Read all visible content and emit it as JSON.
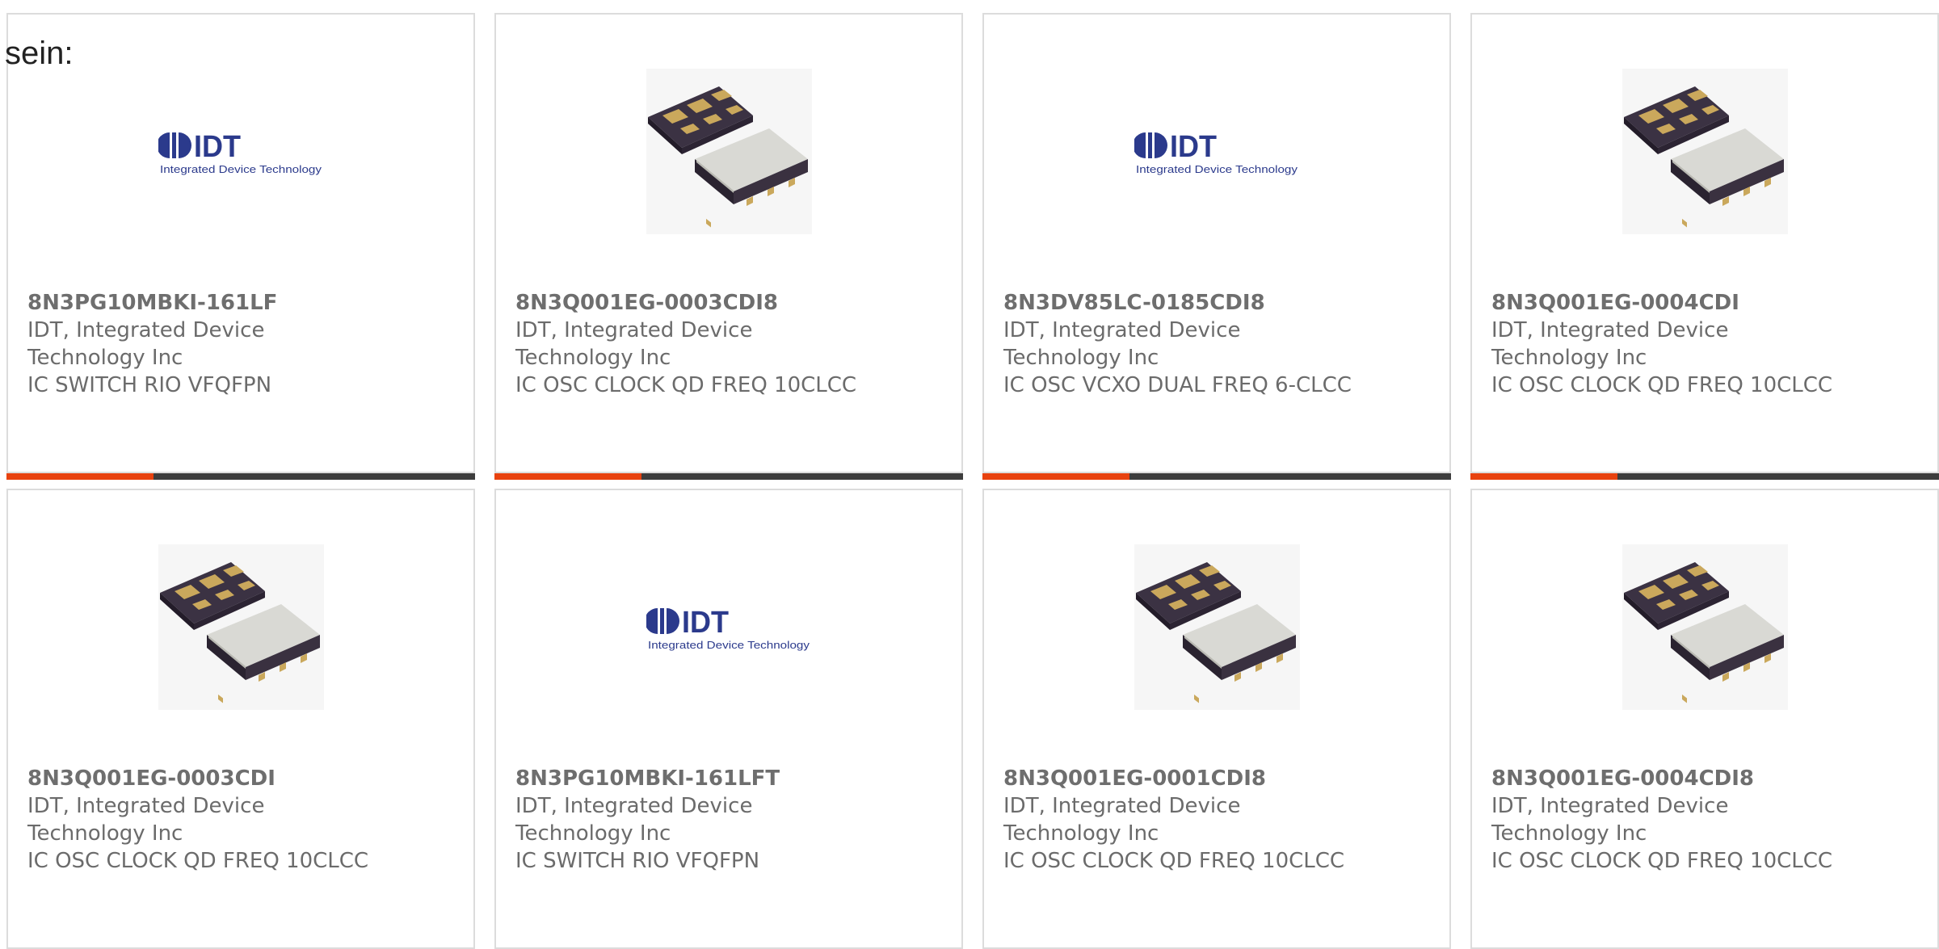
{
  "lead_text": "sein:",
  "logo": {
    "brand": "IDT",
    "tagline": "Integrated Device Technology"
  },
  "colors": {
    "accent": "#e8420f",
    "bar_dark": "#3d3d3d",
    "border": "#dcdcdc",
    "text": "#6b6b6b"
  },
  "products": [
    {
      "part": "8N3PG10MBKI-161LF",
      "mfr_line1": "IDT, Integrated Device",
      "mfr_line2": "Technology Inc",
      "desc": "IC SWITCH RIO VFQFPN",
      "image": "idt-logo"
    },
    {
      "part": "8N3Q001EG-0003CDI8",
      "mfr_line1": "IDT, Integrated Device",
      "mfr_line2": "Technology Inc",
      "desc": "IC OSC CLOCK QD FREQ 10CLCC",
      "image": "chip-photo"
    },
    {
      "part": "8N3DV85LC-0185CDI8",
      "mfr_line1": "IDT, Integrated Device",
      "mfr_line2": "Technology Inc",
      "desc": "IC OSC VCXO DUAL FREQ 6-CLCC",
      "image": "idt-logo"
    },
    {
      "part": "8N3Q001EG-0004CDI",
      "mfr_line1": "IDT, Integrated Device",
      "mfr_line2": "Technology Inc",
      "desc": "IC OSC CLOCK QD FREQ 10CLCC",
      "image": "chip-photo"
    },
    {
      "part": "8N3Q001EG-0003CDI",
      "mfr_line1": "IDT, Integrated Device",
      "mfr_line2": "Technology Inc",
      "desc": "IC OSC CLOCK QD FREQ 10CLCC",
      "image": "chip-photo"
    },
    {
      "part": "8N3PG10MBKI-161LFT",
      "mfr_line1": "IDT, Integrated Device",
      "mfr_line2": "Technology Inc",
      "desc": "IC SWITCH RIO VFQFPN",
      "image": "idt-logo"
    },
    {
      "part": "8N3Q001EG-0001CDI8",
      "mfr_line1": "IDT, Integrated Device",
      "mfr_line2": "Technology Inc",
      "desc": "IC OSC CLOCK QD FREQ 10CLCC",
      "image": "chip-photo"
    },
    {
      "part": "8N3Q001EG-0004CDI8",
      "mfr_line1": "IDT, Integrated Device",
      "mfr_line2": "Technology Inc",
      "desc": "IC OSC CLOCK QD FREQ 10CLCC",
      "image": "chip-photo"
    }
  ]
}
